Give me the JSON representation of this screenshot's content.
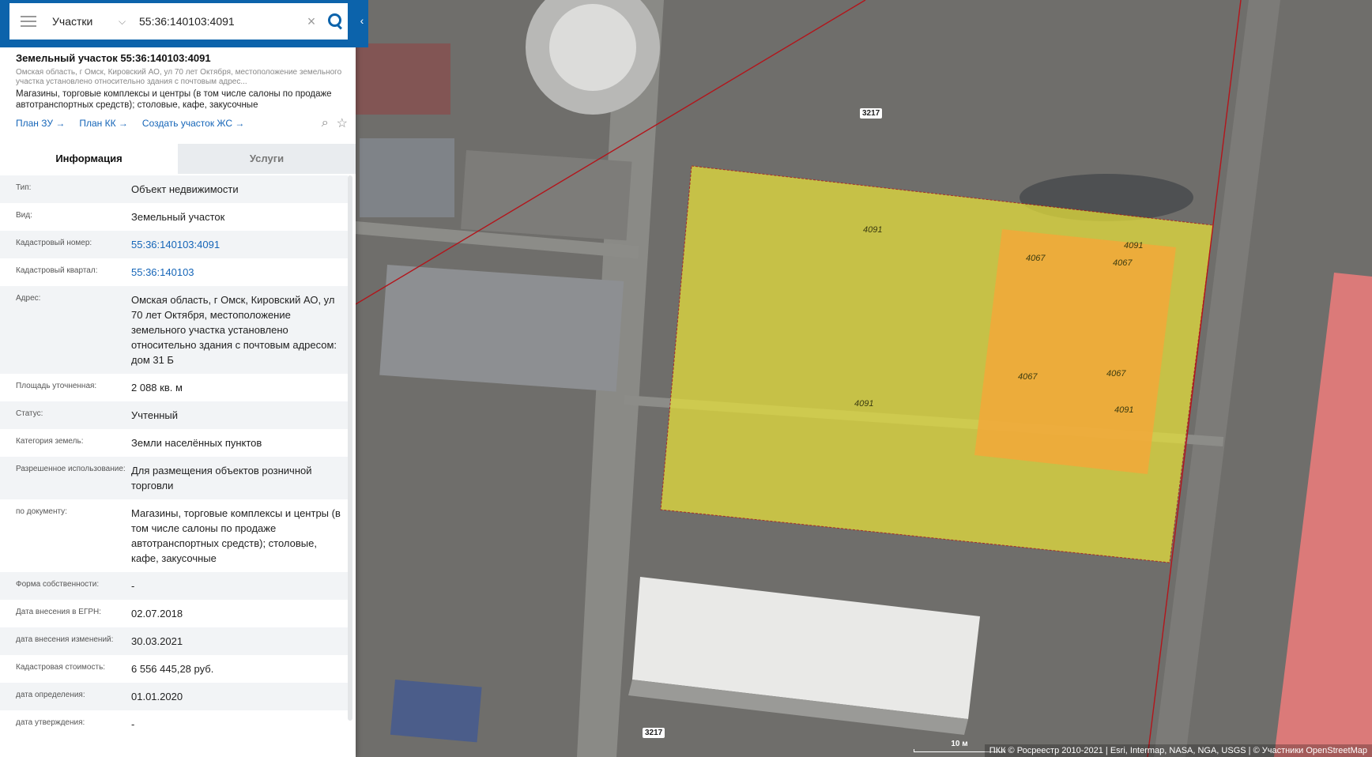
{
  "search": {
    "type_label": "Участки",
    "value": "55:36:140103:4091"
  },
  "header": {
    "title": "Земельный участок 55:36:140103:4091",
    "address": "Омская область, г Омск, Кировский АО, ул 70 лет Октября, местоположение земельного участка установлено относительно здания с почтовым адрес...",
    "purpose": "Магазины, торговые комплексы и центры (в том числе салоны по продаже автотранспортных средств); столовые, кафе, закусочные",
    "links": [
      "План ЗУ →",
      "План КК →",
      "Создать участок ЖС →"
    ]
  },
  "tabs": [
    {
      "label": "Информация",
      "active": true
    },
    {
      "label": "Услуги",
      "active": false
    }
  ],
  "info": [
    {
      "key": "Тип:",
      "value": "Объект недвижимости"
    },
    {
      "key": "Вид:",
      "value": "Земельный участок"
    },
    {
      "key": "Кадастровый номер:",
      "value": "55:36:140103:4091",
      "link": true
    },
    {
      "key": "Кадастровый квартал:",
      "value": "55:36:140103",
      "link": true
    },
    {
      "key": "Адрес:",
      "value": "Омская область, г Омск, Кировский АО, ул 70 лет Октября, местоположение земельного участка установлено относительно здания с почтовым адресом: дом 31 Б"
    },
    {
      "key": "Площадь уточненная:",
      "value": "2 088 кв. м"
    },
    {
      "key": "Статус:",
      "value": "Учтенный"
    },
    {
      "key": "Категория земель:",
      "value": "Земли населённых пунктов"
    },
    {
      "key": "Разрешенное использование:",
      "value": "Для размещения объектов розничной торговли"
    },
    {
      "key": "по документу:",
      "value": "Магазины, торговые комплексы и центры (в том числе салоны по продаже автотранспортных средств); столовые, кафе, закусочные"
    },
    {
      "key": "Форма собственности:",
      "value": "-"
    },
    {
      "key": "Дата внесения в ЕГРН:",
      "value": "02.07.2018"
    },
    {
      "key": "дата внесения изменений:",
      "value": "30.03.2021"
    },
    {
      "key": "Кадастровая стоимость:",
      "value": "6 556 445,28 руб."
    },
    {
      "key": "дата определения:",
      "value": "01.01.2020"
    },
    {
      "key": "дата утверждения:",
      "value": "-"
    }
  ],
  "map": {
    "quarter_labels": [
      "3217",
      "3217"
    ],
    "parcel_labels": [
      "4091",
      "4091",
      "4091",
      "4091",
      "4067",
      "4067",
      "4067",
      "4067"
    ],
    "scale_label": "10 м",
    "attribution": "ПКК © Росреестр 2010-2021 | Esri, Intermap, NASA, NGA, USGS | © Участники OpenStreetMap"
  },
  "colors": {
    "brand": "#0c63ab",
    "link": "#1565b8",
    "parcel_selected": "#e8e23a",
    "parcel_other": "#f2a83a",
    "parcel_pink": "#e07a7a"
  }
}
